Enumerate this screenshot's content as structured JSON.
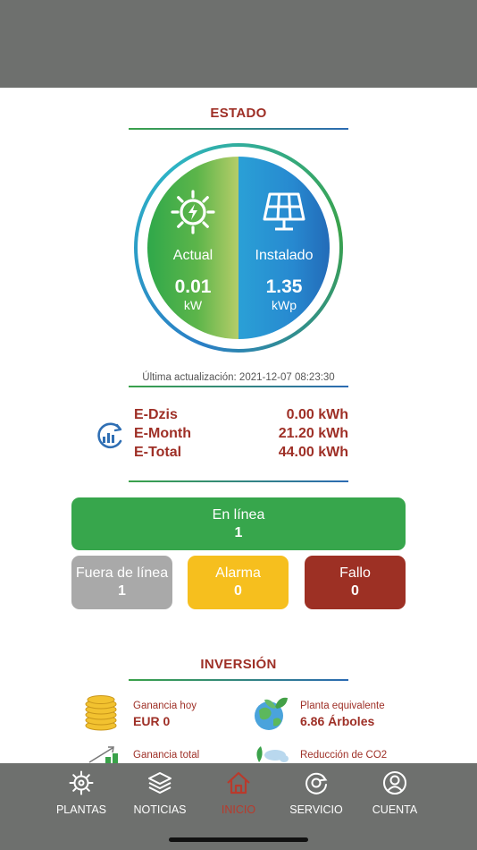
{
  "estado": {
    "title": "ESTADO",
    "actual": {
      "label": "Actual",
      "value": "0.01",
      "unit": "kW",
      "icon": "sun-icon"
    },
    "instalado": {
      "label": "Instalado",
      "value": "1.35",
      "unit": "kWp",
      "icon": "solar-panel-icon"
    },
    "last_update": "Última actualización: 2021-12-07 08:23:30"
  },
  "energy": {
    "icon": "energy-chart-icon",
    "rows": [
      {
        "label": "E-Dzis",
        "value": "0.00 kWh"
      },
      {
        "label": "E-Month",
        "value": "21.20 kWh"
      },
      {
        "label": "E-Total",
        "value": "44.00 kWh"
      }
    ]
  },
  "status": {
    "online": {
      "label": "En línea",
      "count": "1"
    },
    "offline": {
      "label": "Fuera de línea",
      "count": "1"
    },
    "alarm": {
      "label": "Alarma",
      "count": "0"
    },
    "fault": {
      "label": "Fallo",
      "count": "0"
    }
  },
  "inversion": {
    "title": "INVERSIÓN",
    "items": [
      {
        "label": "Ganancia hoy",
        "value": "EUR 0",
        "icon": "coins-icon"
      },
      {
        "label": "Planta equivalente",
        "value": "6.86 Árboles",
        "icon": "globe-tree-icon"
      },
      {
        "label": "Ganancia total",
        "value": "",
        "icon": "growth-chart-icon"
      },
      {
        "label": "Reducción de CO2",
        "value": "",
        "icon": "co2-icon"
      }
    ]
  },
  "nav": {
    "items": [
      {
        "label": "PLANTAS",
        "icon": "gear-icon"
      },
      {
        "label": "NOTICIAS",
        "icon": "layers-icon"
      },
      {
        "label": "INICIO",
        "icon": "home-icon",
        "active": true
      },
      {
        "label": "SERVICIO",
        "icon": "service-icon"
      },
      {
        "label": "CUENTA",
        "icon": "user-icon"
      }
    ]
  },
  "colors": {
    "accent": "#9e2f26",
    "online": "#37a64c",
    "offline": "#a9a9a9",
    "alarm": "#f6bf1e",
    "fault": "#9d3024",
    "bar": "#6e706e"
  }
}
